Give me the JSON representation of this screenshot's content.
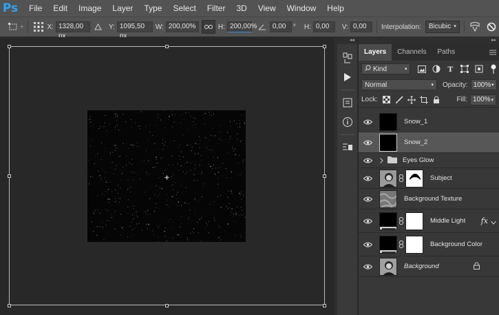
{
  "app": {
    "logo": "Ps",
    "accent": "#2fa3f5"
  },
  "menu": [
    "File",
    "Edit",
    "Image",
    "Layer",
    "Type",
    "Select",
    "Filter",
    "3D",
    "View",
    "Window",
    "Help"
  ],
  "options": {
    "x_label": "X:",
    "x_value": "1328,00 px",
    "y_label": "Y:",
    "y_value": "1095,50 px",
    "w_label": "W:",
    "w_value": "200,00%",
    "h_label": "H:",
    "h_value": "200,00%",
    "angle_value": "0,00",
    "angle_unit": "°",
    "hskew_label": "H:",
    "hskew_value": "0,00",
    "vskew_label": "V:",
    "vskew_value": "0,00",
    "interp_label": "Interpolation:",
    "interp_value": "Bicubic"
  },
  "panel": {
    "tabs": [
      "Layers",
      "Channels",
      "Paths"
    ],
    "active_tab": "Layers",
    "kind_label": "Kind",
    "blend_mode": "Normal",
    "opacity_label": "Opacity:",
    "opacity_value": "100%",
    "lock_label": "Lock:",
    "fill_label": "Fill:",
    "fill_value": "100%",
    "layers": [
      {
        "name": "Snow_1",
        "selected": false,
        "type": "thumb"
      },
      {
        "name": "Snow_2",
        "selected": true,
        "type": "thumb"
      },
      {
        "name": "Eyes Glow",
        "selected": false,
        "type": "group"
      },
      {
        "name": "Subject",
        "selected": false,
        "type": "masked"
      },
      {
        "name": "Background Texture",
        "selected": false,
        "type": "thumb"
      },
      {
        "name": "Middle Light",
        "selected": false,
        "type": "masked",
        "fx": "fx"
      },
      {
        "name": "Background Color",
        "selected": false,
        "type": "masked"
      },
      {
        "name": "Background",
        "selected": false,
        "type": "locked"
      }
    ]
  }
}
